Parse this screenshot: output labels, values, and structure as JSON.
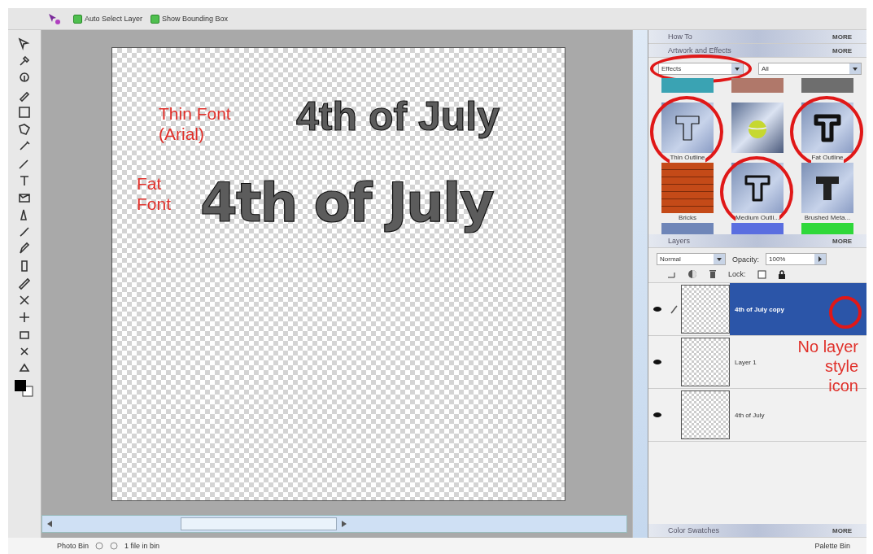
{
  "options_bar": {
    "checkboxes": [
      {
        "label": "Auto Select Layer",
        "checked": true
      },
      {
        "label": "Show Bounding Box",
        "checked": true
      }
    ]
  },
  "document": {
    "annotations": [
      {
        "text": "Thin Font\n(Arial)"
      },
      {
        "text": "Fat\nFont"
      }
    ],
    "text_layers": [
      {
        "text": "4th of July"
      },
      {
        "text": "4th of July"
      }
    ]
  },
  "palettes": {
    "how_to": {
      "title": "How To",
      "more": "MORE"
    },
    "effects": {
      "title": "Artwork and Effects",
      "more": "MORE",
      "category": "Effects",
      "filter": "All",
      "dropdown_circled": true,
      "thumbnails": [
        {
          "kind": "swatch",
          "color": "#3aa3b3",
          "circled": false
        },
        {
          "kind": "swatch",
          "color": "#b0786a",
          "circled": false
        },
        {
          "kind": "swatch",
          "color": "#6e6e6e",
          "circled": false
        },
        {
          "kind": "thin-t",
          "label": "Thin Outline",
          "circled": true
        },
        {
          "kind": "ball",
          "circled": false
        },
        {
          "kind": "fat-t",
          "label": "Fat Outline",
          "circled": true
        },
        {
          "kind": "bricks",
          "label": "Bricks",
          "circled": false
        },
        {
          "kind": "medium-t",
          "label": "Medium Outli...",
          "circled": true
        },
        {
          "kind": "solid-t",
          "label": "Brushed Meta...",
          "circled": false
        },
        {
          "kind": "swatch",
          "color": "#6f86b8",
          "circled": false
        },
        {
          "kind": "swatch",
          "color": "#5a6ee0",
          "circled": false
        },
        {
          "kind": "swatch",
          "color": "#2fd83a",
          "circled": false
        }
      ]
    },
    "layers": {
      "title": "Layers",
      "more": "MORE",
      "blend_mode": "Normal",
      "opacity_label": "Opacity:",
      "opacity": "100%",
      "lock_label": "Lock:",
      "items": [
        {
          "name": "4th of July copy",
          "selected": true,
          "visible": true,
          "editing": true,
          "circled": true
        },
        {
          "name": "Layer 1",
          "selected": false,
          "visible": true,
          "editing": false,
          "circled": false
        },
        {
          "name": "4th of July",
          "selected": false,
          "visible": true,
          "editing": false,
          "circled": false
        }
      ],
      "annotation": "No layer\nstyle\nicon"
    },
    "color_swatches": {
      "title": "Color Swatches",
      "more": "MORE"
    }
  },
  "status_bar": {
    "photo_bin": "Photo Bin",
    "file_count": "1 file in bin",
    "palette_bin": "Palette Bin"
  }
}
